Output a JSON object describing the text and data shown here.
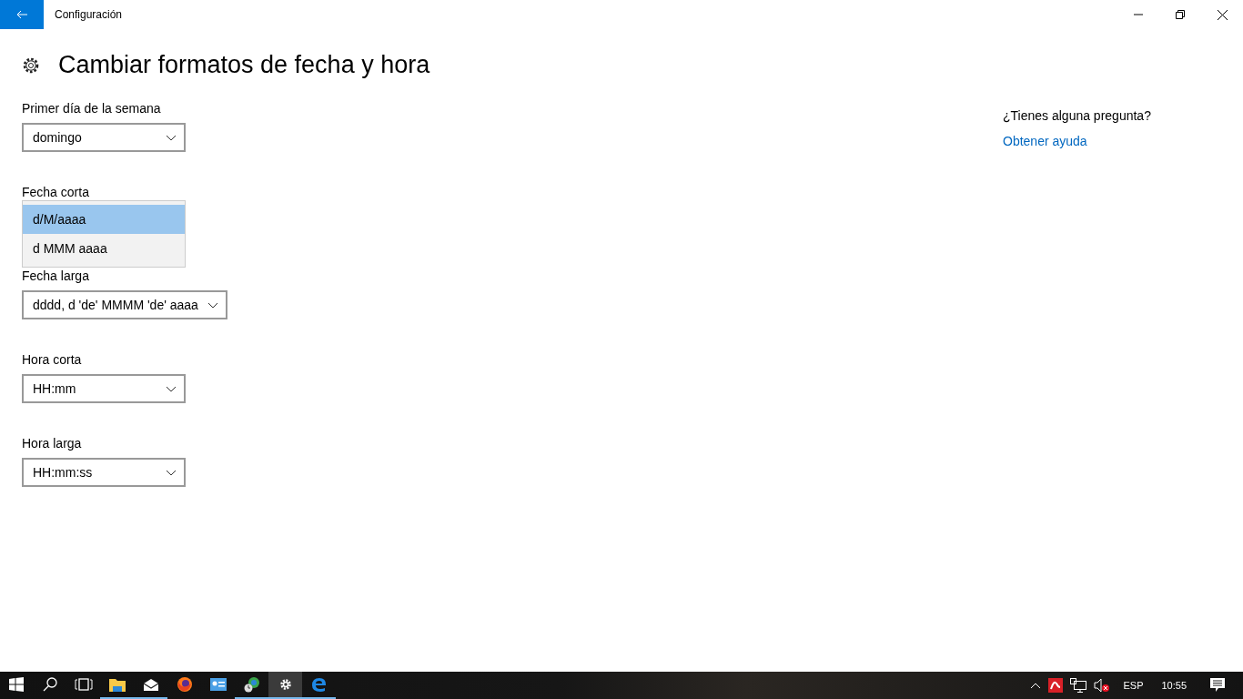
{
  "window": {
    "title": "Configuración"
  },
  "page": {
    "title": "Cambiar formatos de fecha y hora"
  },
  "fields": [
    {
      "label": "Primer día de la semana",
      "value": "domingo",
      "expanded": false
    },
    {
      "label": "Fecha corta",
      "expanded": true,
      "options": [
        {
          "label": "d/M/aaaa",
          "selected": true
        },
        {
          "label": "d MMM aaaa",
          "selected": false
        }
      ]
    },
    {
      "label": "Fecha larga",
      "value": "dddd, d 'de' MMMM 'de' aaaa",
      "expanded": false
    },
    {
      "label": "Hora corta",
      "value": "HH:mm",
      "expanded": false
    },
    {
      "label": "Hora larga",
      "value": "HH:mm:ss",
      "expanded": false
    }
  ],
  "help": {
    "question": "¿Tienes alguna pregunta?",
    "link": "Obtener ayuda"
  },
  "taskbar": {
    "apps": [
      {
        "kind": "explorer",
        "running": true,
        "selected": false
      },
      {
        "kind": "mail",
        "running": true,
        "selected": false
      },
      {
        "kind": "firefox",
        "running": false,
        "selected": false
      },
      {
        "kind": "contact",
        "running": false,
        "selected": false
      },
      {
        "kind": "network",
        "running": true,
        "selected": false
      },
      {
        "kind": "settings",
        "running": true,
        "selected": true
      },
      {
        "kind": "edge",
        "running": true,
        "selected": false
      }
    ],
    "language": "ESP",
    "time": "10:55"
  }
}
